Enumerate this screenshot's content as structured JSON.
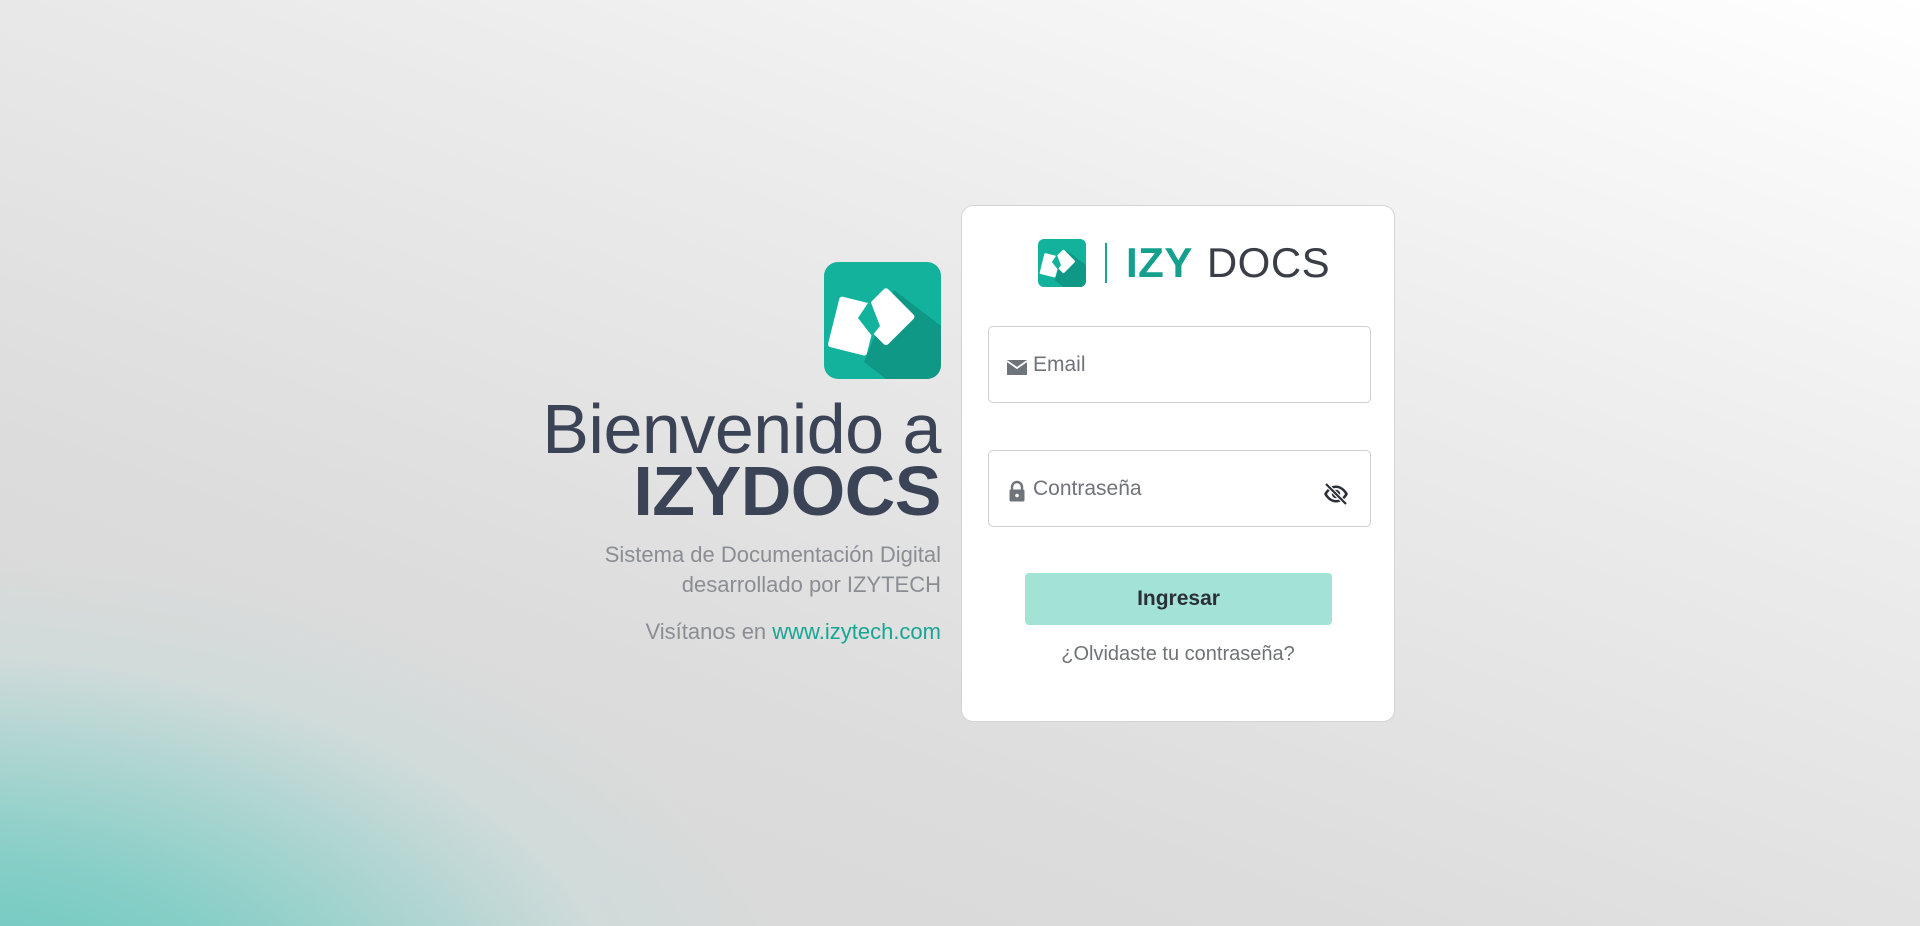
{
  "welcome": {
    "greeting": "Bienvenido a",
    "brand": "IZYDOCS",
    "subtitle_line1": "Sistema de Documentación Digital",
    "subtitle_line2": "desarrollado por IZYTECH",
    "visit_prefix": "Visítanos en ",
    "visit_link": "www.izytech.com"
  },
  "card": {
    "logo_izy": "IZY",
    "logo_docs": "DOCS",
    "email": {
      "placeholder": "Email",
      "value": "",
      "icon": "envelope-icon"
    },
    "password": {
      "placeholder": "Contraseña",
      "value": "",
      "icon": "lock-icon",
      "toggle_icon": "eye-off-icon"
    },
    "submit_label": "Ingresar",
    "forgot_label": "¿Olvidaste tu contraseña?"
  },
  "colors": {
    "brand_teal": "#15a08e",
    "button_bg": "#a3e3d6",
    "text_dark": "#3a4456",
    "text_muted": "#8a8d93"
  }
}
